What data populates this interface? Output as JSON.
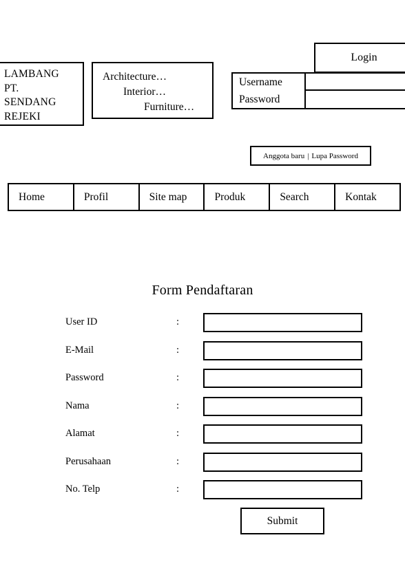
{
  "header": {
    "logo": {
      "lines": [
        "LAMBANG",
        "PT.",
        "SENDANG",
        "REJEKI"
      ]
    },
    "tagline": {
      "lines": [
        "Architecture…",
        "Interior…",
        "Furniture…"
      ]
    }
  },
  "login": {
    "title": "Login",
    "fields": [
      {
        "label": "Username",
        "value": "",
        "placeholder": ""
      },
      {
        "label": "Password",
        "value": "",
        "placeholder": ""
      }
    ],
    "links": {
      "new_member": "Anggota baru",
      "separator": "|",
      "forgot_password": "Lupa Password"
    }
  },
  "nav": {
    "items": [
      {
        "label": "Home"
      },
      {
        "label": "Profil"
      },
      {
        "label": "Site map"
      },
      {
        "label": "Produk"
      },
      {
        "label": "Search"
      },
      {
        "label": "Kontak"
      }
    ]
  },
  "form": {
    "title": "Form Pendaftaran",
    "colon": ":",
    "fields": [
      {
        "label": "User ID",
        "value": "",
        "placeholder": ""
      },
      {
        "label": "E-Mail",
        "value": "",
        "placeholder": ""
      },
      {
        "label": "Password",
        "value": "",
        "placeholder": ""
      },
      {
        "label": "Nama",
        "value": "",
        "placeholder": ""
      },
      {
        "label": "Alamat",
        "value": "",
        "placeholder": ""
      },
      {
        "label": "Perusahaan",
        "value": "",
        "placeholder": ""
      },
      {
        "label": "No. Telp",
        "value": "",
        "placeholder": ""
      }
    ],
    "submit_label": "Submit"
  },
  "colors": {
    "background": "#ffffff",
    "border": "#000000",
    "text": "#000000"
  }
}
